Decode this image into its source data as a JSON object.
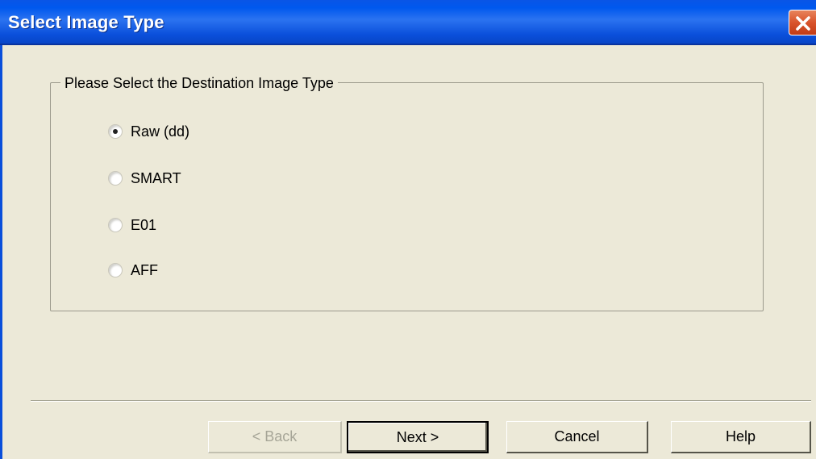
{
  "window": {
    "title": "Select Image Type",
    "close_icon": "close-icon",
    "colors": {
      "titlebar": "#0a55e6",
      "face": "#ece9d8",
      "close": "#d9532b"
    }
  },
  "group": {
    "legend": "Please Select the Destination Image Type",
    "options": [
      {
        "label": "Raw (dd)",
        "selected": true
      },
      {
        "label": "SMART",
        "selected": false
      },
      {
        "label": "E01",
        "selected": false
      },
      {
        "label": "AFF",
        "selected": false
      }
    ]
  },
  "buttons": {
    "back": "< Back",
    "next": "Next >",
    "cancel": "Cancel",
    "help": "Help"
  }
}
